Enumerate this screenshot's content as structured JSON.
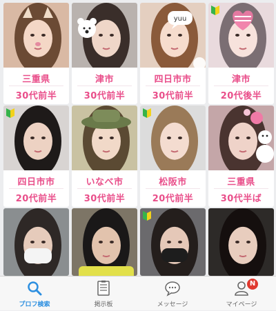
{
  "profiles": [
    {
      "area": "三重県",
      "age": "30代前半",
      "bg": "#d9b9a4",
      "hair": "#6b4a34",
      "skin": "#f4d7c6",
      "beginner": false,
      "sticker": "cat"
    },
    {
      "area": "津市",
      "age": "30代前半",
      "bg": "#b9b2ae",
      "hair": "#3a2e2a",
      "skin": "#efd6c8",
      "beginner": false,
      "sticker": "bear"
    },
    {
      "area": "四日市市",
      "age": "30代前半",
      "bg": "#e4cfc0",
      "hair": "#8a5a3a",
      "skin": "#f6dccd",
      "beginner": false,
      "sticker": "bubble",
      "sticker_text": "yuu"
    },
    {
      "area": "津市",
      "age": "20代後半",
      "bg": "#e9dadd",
      "hair": "#7b6e73",
      "skin": "#f7e2dc",
      "beginner": true,
      "sticker": "heart"
    },
    {
      "area": "四日市市",
      "age": "20代前半",
      "bg": "#d8d4d2",
      "hair": "#1e1a19",
      "skin": "#edd2c3",
      "beginner": true,
      "sticker": "none"
    },
    {
      "area": "いなべ市",
      "age": "30代前半",
      "bg": "#c9c2a2",
      "hair": "#5b4a33",
      "skin": "#f1d9c8",
      "beginner": false,
      "sticker": "hat"
    },
    {
      "area": "松阪市",
      "age": "20代前半",
      "bg": "#dcdcdc",
      "hair": "#9a7a58",
      "skin": "#f4dcd0",
      "beginner": true,
      "sticker": "none"
    },
    {
      "area": "三重県",
      "age": "30代半ば",
      "bg": "#c4a6a8",
      "hair": "#4a3430",
      "skin": "#efd3c9",
      "beginner": false,
      "sticker": "snowman"
    },
    {
      "area": "",
      "age": "",
      "bg": "#8a8e90",
      "hair": "#2e2826",
      "skin": "#e6cbbb",
      "beginner": false,
      "sticker": "mask-white"
    },
    {
      "area": "",
      "age": "",
      "bg": "#7d7566",
      "hair": "#1a1818",
      "skin": "#e2c3ad",
      "beginner": false,
      "sticker": "yellow-shirt"
    },
    {
      "area": "",
      "age": "",
      "bg": "#6b6a6d",
      "hair": "#241e1c",
      "skin": "#e5c8b8",
      "beginner": true,
      "sticker": "mask-black"
    },
    {
      "area": "",
      "age": "",
      "bg": "#2d2a28",
      "hair": "#150f0e",
      "skin": "#e8cdbe",
      "beginner": false,
      "sticker": "none"
    }
  ],
  "tabs": [
    {
      "label": "プロフ検索",
      "icon": "search-icon",
      "active": true
    },
    {
      "label": "掲示板",
      "icon": "board-icon",
      "active": false
    },
    {
      "label": "メッセージ",
      "icon": "message-icon",
      "active": false
    },
    {
      "label": "マイページ",
      "icon": "user-icon",
      "active": false,
      "badge": "N"
    }
  ],
  "colors": {
    "accent_text": "#e94e8a",
    "active_tab": "#2c8fe0",
    "badge": "#e0392f"
  }
}
